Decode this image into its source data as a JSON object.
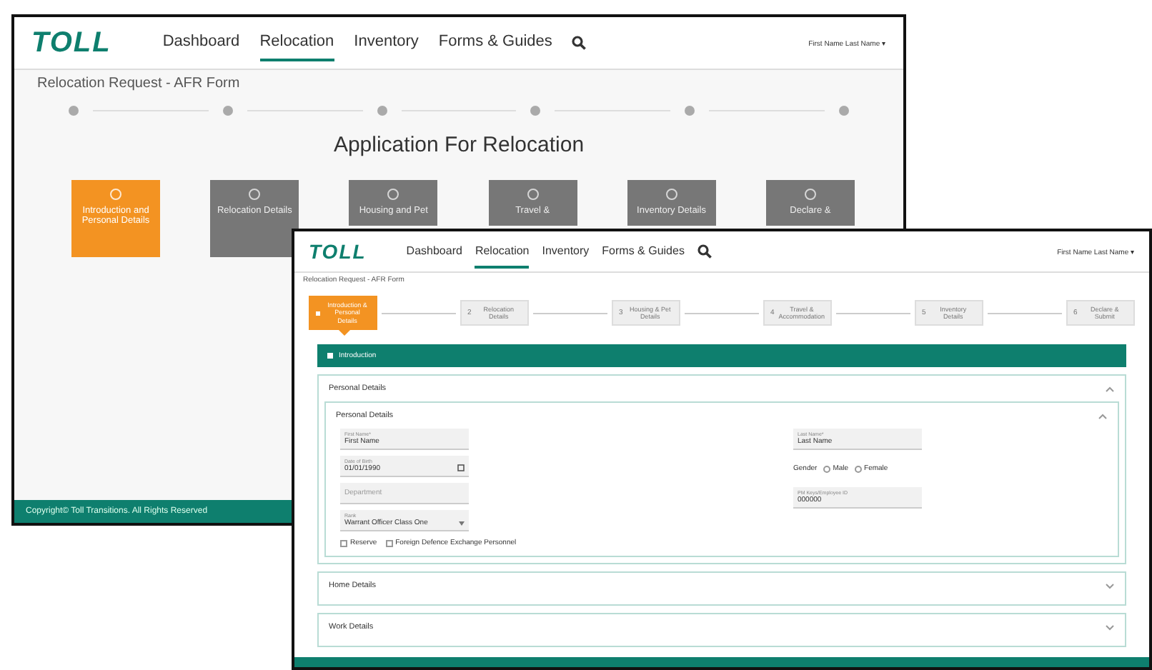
{
  "back_window": {
    "header": {
      "logo": "TOLL",
      "nav": [
        {
          "label": "Dashboard",
          "selected": false
        },
        {
          "label": "Relocation",
          "selected": true
        },
        {
          "label": "Inventory",
          "selected": false
        },
        {
          "label": "Forms & Guides",
          "selected": false
        }
      ],
      "user": "First Name Last Name ▾"
    },
    "breadcrumb": "Relocation Request - AFR Form",
    "title": "Application For Relocation",
    "tiles": [
      {
        "label": "Introduction and Personal Details",
        "selected": true
      },
      {
        "label": "Relocation Details",
        "selected": false
      },
      {
        "label": "Housing and Pet",
        "selected": false
      },
      {
        "label": "Travel &",
        "selected": false
      },
      {
        "label": "Inventory Details",
        "selected": false
      },
      {
        "label": "Declare &",
        "selected": false
      }
    ],
    "footer": "Copyright© Toll Transitions. All Rights Reserved"
  },
  "front_window": {
    "header": {
      "logo": "TOLL",
      "nav": [
        {
          "label": "Dashboard",
          "selected": false
        },
        {
          "label": "Relocation",
          "selected": true
        },
        {
          "label": "Inventory",
          "selected": false
        },
        {
          "label": "Forms & Guides",
          "selected": false
        }
      ],
      "user": "First Name Last Name ▾"
    },
    "breadcrumb": "Relocation Request - AFR Form",
    "steps": [
      {
        "label": "Introduction & Personal Details",
        "selected": true
      },
      {
        "number": "2",
        "label": "Relocation Details",
        "selected": false
      },
      {
        "number": "3",
        "label": "Housing & Pet Details",
        "selected": false
      },
      {
        "number": "4",
        "label": "Travel & Accommodation",
        "selected": false
      },
      {
        "number": "5",
        "label": "Inventory Details",
        "selected": false
      },
      {
        "number": "6",
        "label": "Declare & Submit",
        "selected": false
      }
    ],
    "introduction": {
      "title": "Introduction"
    },
    "sections": [
      {
        "title": "Personal Details",
        "expanded": true,
        "subsection": {
          "title": "Personal Details",
          "expanded": true,
          "left_fields": [
            {
              "kind": "text",
              "label": "First Name*",
              "value": "First Name"
            },
            {
              "kind": "date",
              "label": "Date of Birth",
              "value": "01/01/1990"
            },
            {
              "kind": "text",
              "placeholder": "Department"
            },
            {
              "kind": "select",
              "label": "Rank",
              "value": "Warrant Officer Class One"
            }
          ],
          "right_fields": [
            {
              "kind": "text",
              "label": "Last Name*",
              "value": "Last Name"
            },
            {
              "kind": "radio",
              "label": "Gender",
              "options": [
                {
                  "label": "Male",
                  "selected": false
                },
                {
                  "label": "Female",
                  "selected": false
                }
              ]
            },
            {
              "kind": "text",
              "label": "PM Keys/Employee ID",
              "value": "000000"
            }
          ],
          "checkboxes": [
            {
              "label": "Reserve",
              "checked": false
            },
            {
              "label": "Foreign Defence Exchange Personnel",
              "checked": false
            }
          ]
        }
      },
      {
        "title": "Home Details",
        "expanded": false
      },
      {
        "title": "Work Details",
        "expanded": false
      }
    ]
  }
}
